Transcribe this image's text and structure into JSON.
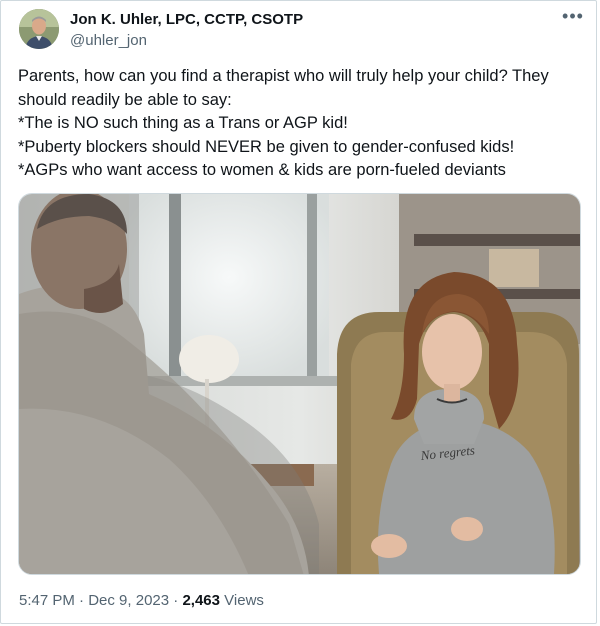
{
  "author": {
    "display_name": "Jon K. Uhler, LPC, CCTP, CSOTP",
    "handle": "@uhler_jon"
  },
  "more_menu": {
    "icon": "more-horizontal-icon",
    "glyph": "•••"
  },
  "tweet": {
    "lines": [
      "Parents, how can you find a therapist who will truly help your child? They",
      "should readily be able to say:",
      "*The is NO such thing as a Trans or AGP kid!",
      "*Puberty blockers should NEVER be given to gender-confused kids!",
      "*AGPs who want access to women & kids are porn-fueled deviants"
    ]
  },
  "media": {
    "sweatshirt_text": "No regrets"
  },
  "meta": {
    "time": "5:47 PM",
    "separator": "·",
    "date": "Dec 9, 2023",
    "views_count": "2,463",
    "views_label": "Views"
  },
  "colors": {
    "text_primary": "#0f1419",
    "text_secondary": "#536471",
    "border": "#cfd9de"
  }
}
